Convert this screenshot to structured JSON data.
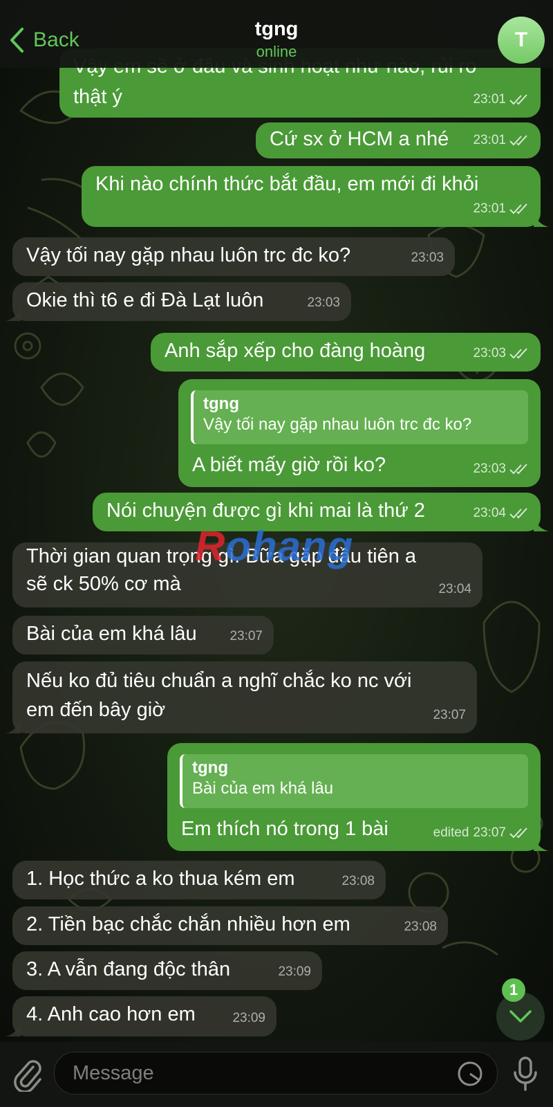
{
  "header": {
    "back_label": "Back",
    "title": "tgng",
    "status": "online",
    "avatar_letter": "T"
  },
  "messages": [
    {
      "direction": "out",
      "lines": [
        "Vậy em sẽ ở đâu và sinh hoạt như nào, rủi ro",
        "thật ý"
      ],
      "time": "23:01",
      "ticks": "read"
    },
    {
      "direction": "out",
      "lines": [
        "Cứ sx ở HCM a nhé"
      ],
      "time": "23:01",
      "ticks": "read"
    },
    {
      "direction": "out",
      "lines": [
        "Khi nào chính thức bắt đầu, em mới đi khỏi"
      ],
      "time": "23:01",
      "ticks": "read"
    },
    {
      "direction": "in",
      "lines": [
        "Vậy tối nay gặp nhau luôn trc đc ko?"
      ],
      "time": "23:03"
    },
    {
      "direction": "in",
      "lines": [
        "Okie thì t6 e đi Đà Lạt luôn"
      ],
      "time": "23:03"
    },
    {
      "direction": "out",
      "lines": [
        "Anh sắp xếp cho đàng hoàng"
      ],
      "time": "23:03",
      "ticks": "read"
    },
    {
      "direction": "out",
      "reply_to": {
        "name": "tgng",
        "text": "Vậy tối nay gặp nhau luôn trc đc ko?"
      },
      "lines": [
        "A biết mấy giờ rồi ko?"
      ],
      "time": "23:03",
      "ticks": "read"
    },
    {
      "direction": "out",
      "lines": [
        "Nói chuyện được gì khi mai là thứ 2"
      ],
      "time": "23:04",
      "ticks": "read"
    },
    {
      "direction": "in",
      "lines": [
        "Thời gian quan trọng gì. Bữa gặp đầu tiên a",
        "sẽ ck 50% cơ mà"
      ],
      "time": "23:04"
    },
    {
      "direction": "in",
      "lines": [
        "Bài của em khá lâu"
      ],
      "time": "23:07"
    },
    {
      "direction": "in",
      "lines": [
        "Nếu ko đủ tiêu chuẩn a nghĩ chắc ko nc với",
        "em đến bây giờ"
      ],
      "time": "23:07"
    },
    {
      "direction": "out",
      "reply_to": {
        "name": "tgng",
        "text": "Bài của em khá lâu"
      },
      "lines": [
        "Em thích nó trong 1 bài"
      ],
      "time": "23:07",
      "edited": "edited",
      "ticks": "read"
    },
    {
      "direction": "in",
      "lines": [
        "1. Học thức a ko thua kém em"
      ],
      "time": "23:08"
    },
    {
      "direction": "in",
      "lines": [
        "2. Tiền bạc chắc chắn nhiều hơn em"
      ],
      "time": "23:08"
    },
    {
      "direction": "in",
      "lines": [
        "3. A vẫn đang độc thân"
      ],
      "time": "23:09"
    },
    {
      "direction": "in",
      "lines": [
        "4. Anh cao hơn em"
      ],
      "time": "23:09"
    }
  ],
  "watermark": {
    "first": "R",
    "rest": "ohang"
  },
  "scroll_down": {
    "unread_count": "1"
  },
  "composer": {
    "placeholder": "Message"
  },
  "icons": {
    "back": "chevron-left-icon",
    "attach": "paperclip-icon",
    "sticker": "sticker-icon",
    "mic": "microphone-icon",
    "scroll": "chevron-down-icon",
    "read": "double-check-icon"
  },
  "colors": {
    "accent": "#63c759",
    "outgoing_bubble": "#4a9a37",
    "incoming_bubble": "#34362e",
    "background": "#0b0f0a"
  }
}
